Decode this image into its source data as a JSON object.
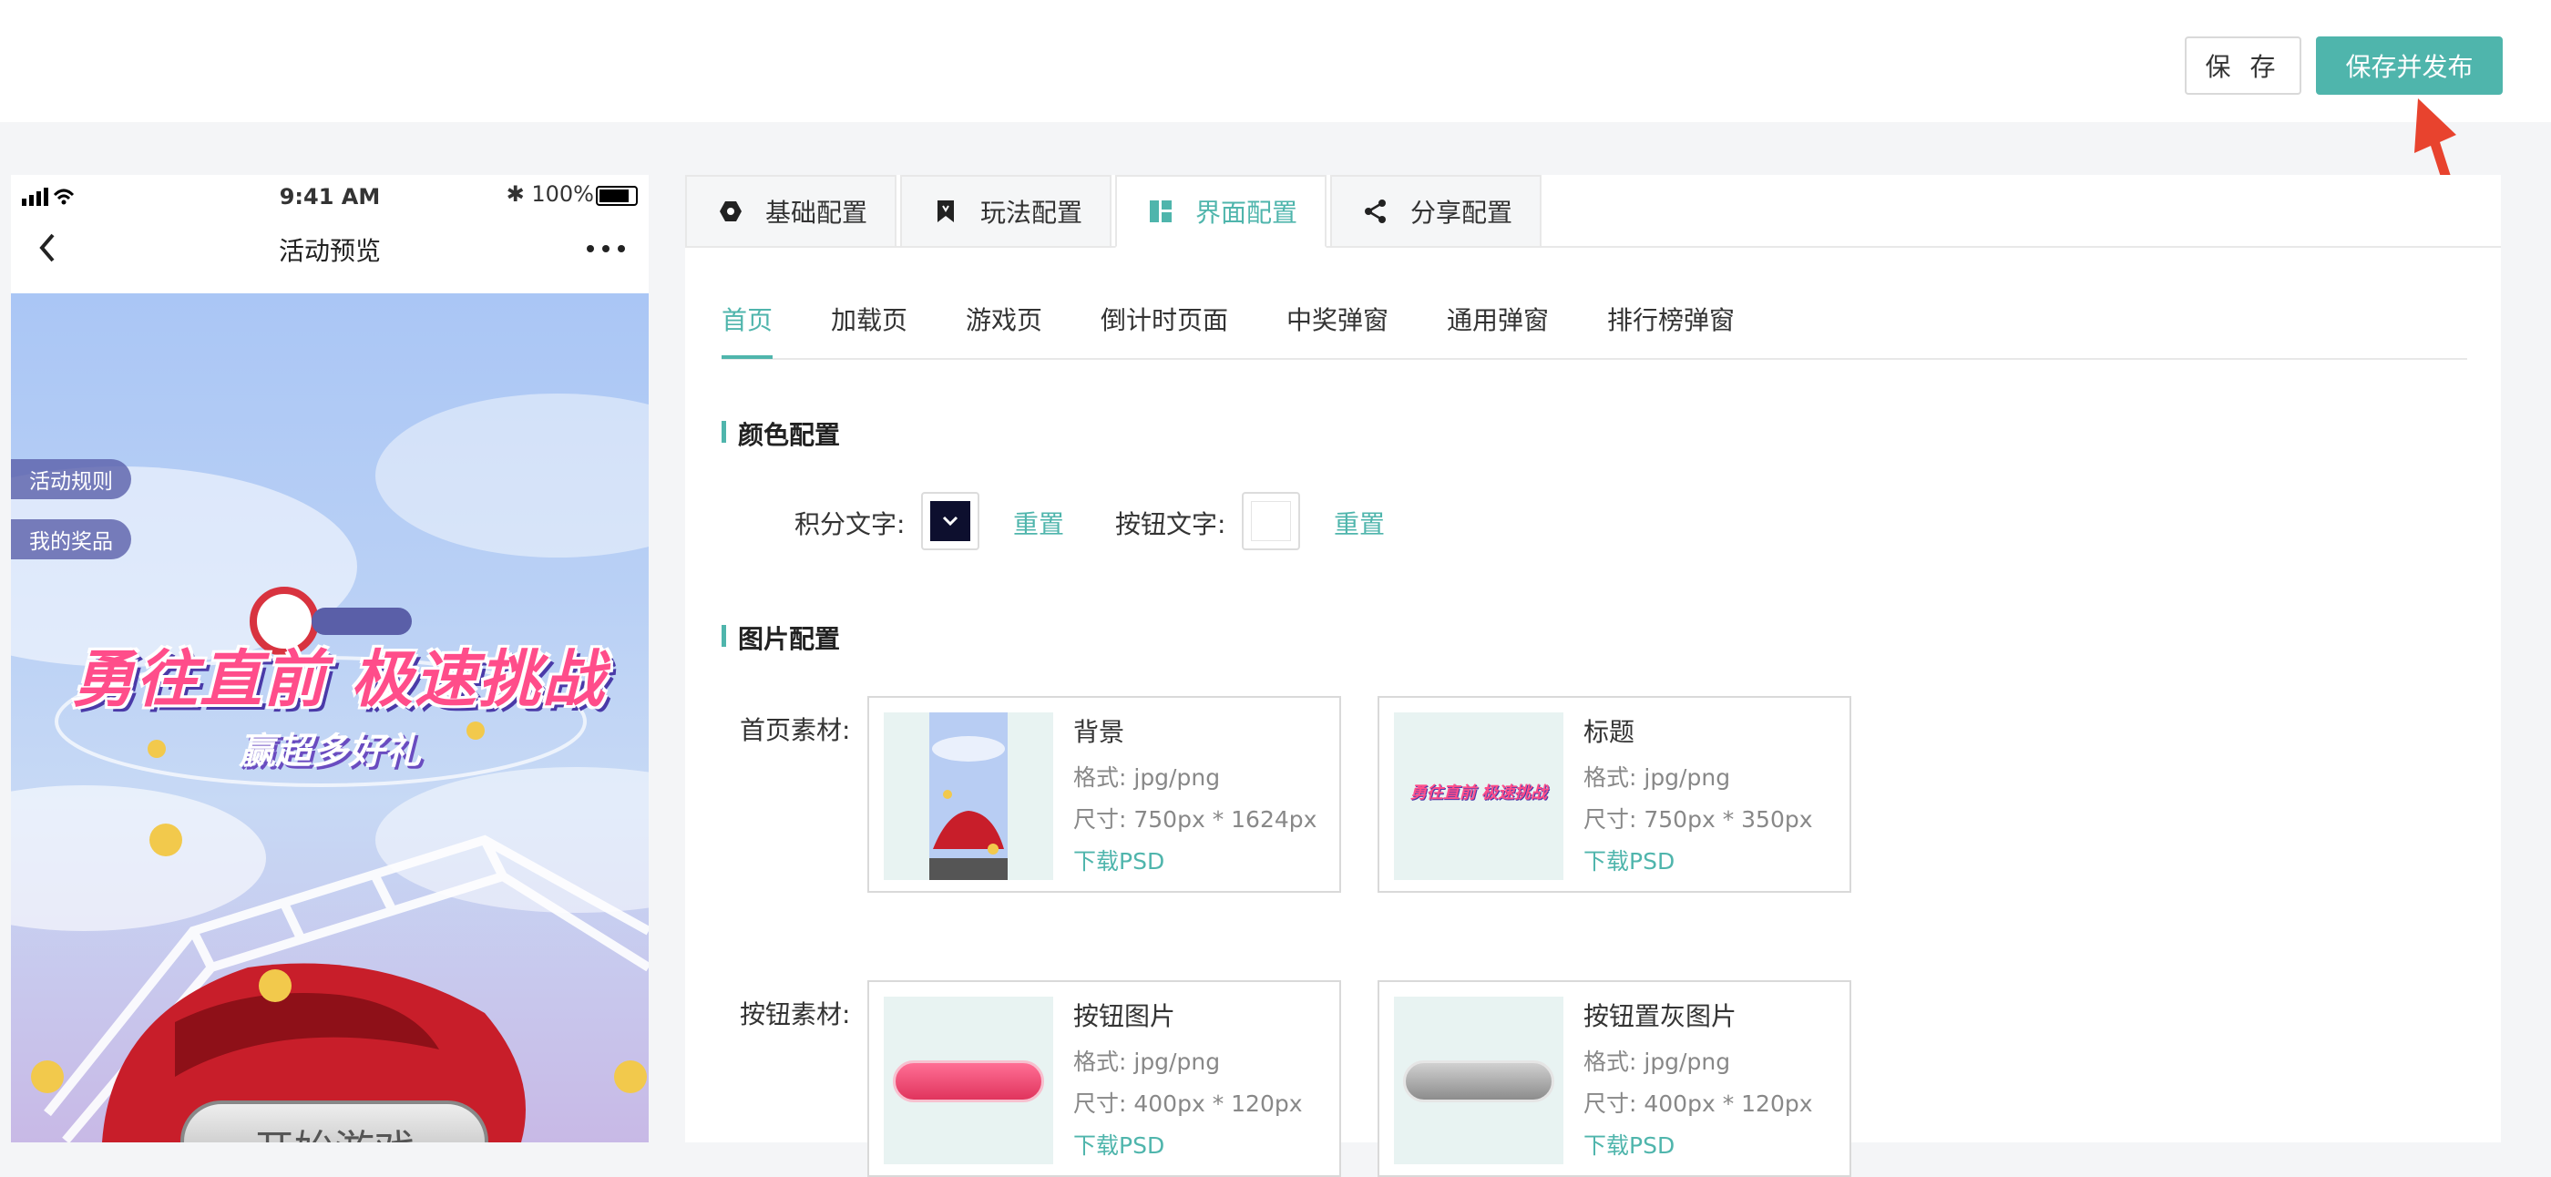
{
  "header": {
    "save_label": "保 存",
    "publish_label": "保存并发布"
  },
  "phone": {
    "status": {
      "time": "9:41 AM",
      "battery": "100%"
    },
    "nav_title": "活动预览",
    "side_buttons": [
      "活动规则",
      "我的奖品"
    ],
    "headline": "勇往直前 极速挑战",
    "subhead": "赢超多好礼",
    "start_button": "开始游戏"
  },
  "tabs": [
    {
      "label": "基础配置",
      "icon": "hexagon-icon"
    },
    {
      "label": "玩法配置",
      "icon": "bookmark-icon"
    },
    {
      "label": "界面配置",
      "icon": "layout-icon",
      "active": true
    },
    {
      "label": "分享配置",
      "icon": "share-icon"
    }
  ],
  "subtabs": [
    "首页",
    "加载页",
    "游戏页",
    "倒计时页面",
    "中奖弹窗",
    "通用弹窗",
    "排行榜弹窗"
  ],
  "color_section": {
    "title": "颜色配置",
    "points_label": "积分文字:",
    "points_color": "#0d0f2e",
    "button_label": "按钮文字:",
    "button_color": "#ffffff",
    "reset": "重置"
  },
  "image_section": {
    "title": "图片配置",
    "home_label": "首页素材:",
    "button_label": "按钮素材:",
    "cards": [
      {
        "name": "背景",
        "format": "格式: jpg/png",
        "size": "尺寸: 750px * 1624px",
        "download": "下载PSD"
      },
      {
        "name": "标题",
        "format": "格式: jpg/png",
        "size": "尺寸: 750px * 350px",
        "download": "下载PSD"
      },
      {
        "name": "按钮图片",
        "format": "格式: jpg/png",
        "size": "尺寸: 400px * 120px",
        "download": "下载PSD"
      },
      {
        "name": "按钮置灰图片",
        "format": "格式: jpg/png",
        "size": "尺寸: 400px * 120px",
        "download": "下载PSD"
      }
    ],
    "thumb_title_text": "勇往直前 极速挑战"
  },
  "colors": {
    "accent": "#4fb5ac",
    "annotation_arrow": "#e8432e"
  }
}
